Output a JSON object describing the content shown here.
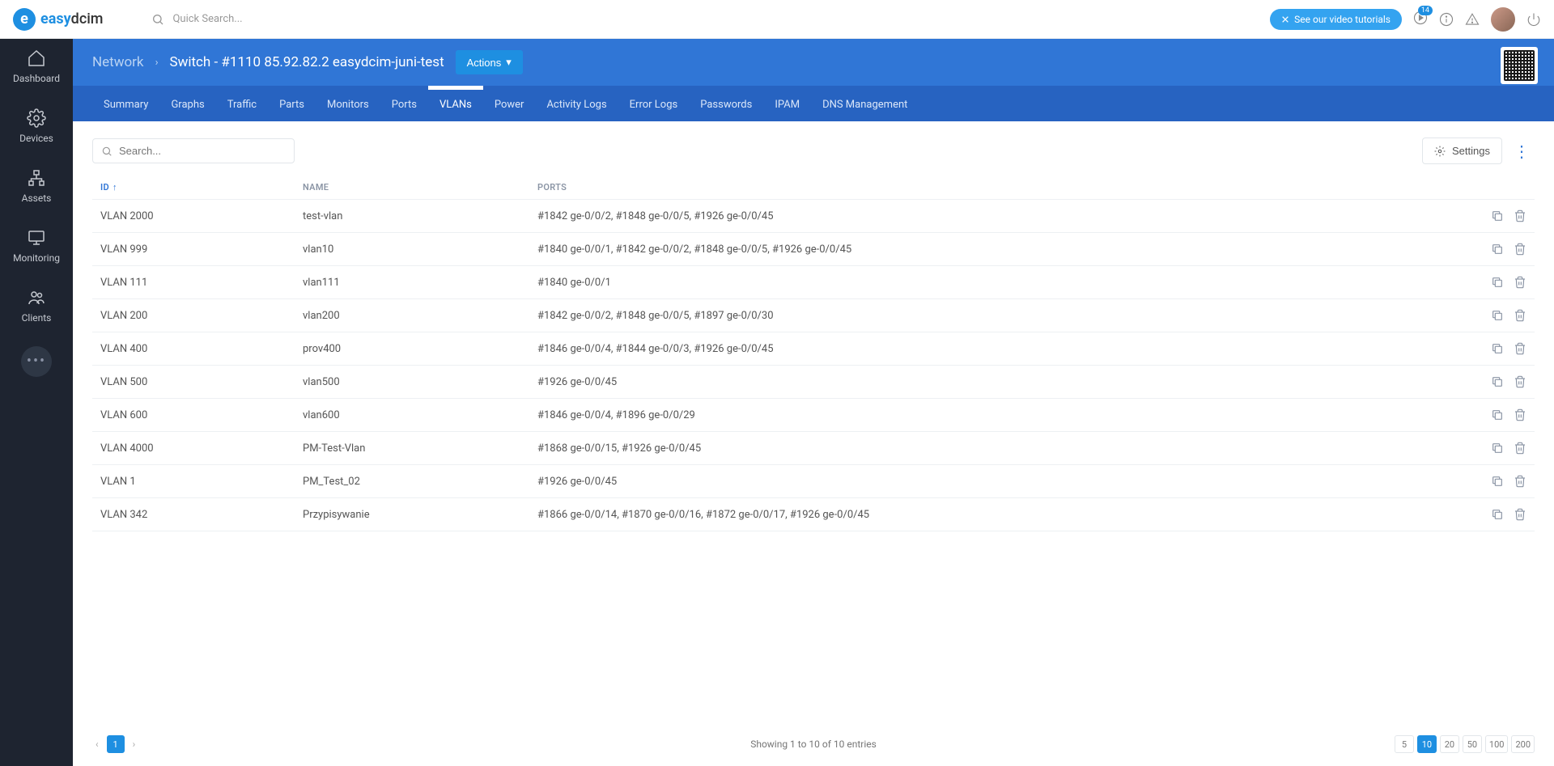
{
  "header": {
    "logo_text_a": "easy",
    "logo_text_b": "dcim",
    "quick_search_placeholder": "Quick Search...",
    "tutorials_label": "See our video tutorials",
    "badge_count": "14"
  },
  "sidebar": {
    "items": [
      {
        "key": "dashboard",
        "label": "Dashboard"
      },
      {
        "key": "devices",
        "label": "Devices"
      },
      {
        "key": "assets",
        "label": "Assets"
      },
      {
        "key": "monitoring",
        "label": "Monitoring"
      },
      {
        "key": "clients",
        "label": "Clients"
      }
    ]
  },
  "breadcrumb": {
    "section": "Network",
    "current": "Switch - #1110 85.92.82.2 easydcim-juni-test",
    "actions_label": "Actions"
  },
  "tabs": {
    "active": "VLANs",
    "items": [
      "Summary",
      "Graphs",
      "Traffic",
      "Parts",
      "Monitors",
      "Ports",
      "VLANs",
      "Power",
      "Activity Logs",
      "Error Logs",
      "Passwords",
      "IPAM",
      "DNS Management"
    ]
  },
  "toolbar": {
    "search_placeholder": "Search...",
    "settings_label": "Settings"
  },
  "table": {
    "columns": {
      "id": "ID",
      "name": "NAME",
      "ports": "PORTS"
    },
    "rows": [
      {
        "id": "VLAN 2000",
        "name": "test-vlan",
        "ports": "#1842 ge-0/0/2, #1848 ge-0/0/5, #1926 ge-0/0/45"
      },
      {
        "id": "VLAN 999",
        "name": "vlan10",
        "ports": "#1840 ge-0/0/1, #1842 ge-0/0/2, #1848 ge-0/0/5, #1926 ge-0/0/45"
      },
      {
        "id": "VLAN 111",
        "name": "vlan111",
        "ports": "#1840 ge-0/0/1"
      },
      {
        "id": "VLAN 200",
        "name": "vlan200",
        "ports": "#1842 ge-0/0/2, #1848 ge-0/0/5, #1897 ge-0/0/30"
      },
      {
        "id": "VLAN 400",
        "name": "prov400",
        "ports": "#1846 ge-0/0/4, #1844 ge-0/0/3, #1926 ge-0/0/45"
      },
      {
        "id": "VLAN 500",
        "name": "vlan500",
        "ports": "#1926 ge-0/0/45"
      },
      {
        "id": "VLAN 600",
        "name": "vlan600",
        "ports": "#1846 ge-0/0/4, #1896 ge-0/0/29"
      },
      {
        "id": "VLAN 4000",
        "name": "PM-Test-Vlan",
        "ports": "#1868 ge-0/0/15, #1926 ge-0/0/45"
      },
      {
        "id": "VLAN 1",
        "name": "PM_Test_02",
        "ports": "#1926 ge-0/0/45"
      },
      {
        "id": "VLAN 342",
        "name": "Przypisywanie",
        "ports": "#1866 ge-0/0/14, #1870 ge-0/0/16, #1872 ge-0/0/17, #1926 ge-0/0/45"
      }
    ]
  },
  "footer": {
    "current_page": "1",
    "summary": "Showing 1 to 10 of 10 entries",
    "page_sizes": [
      "5",
      "10",
      "20",
      "50",
      "100",
      "200"
    ],
    "active_size": "10"
  }
}
